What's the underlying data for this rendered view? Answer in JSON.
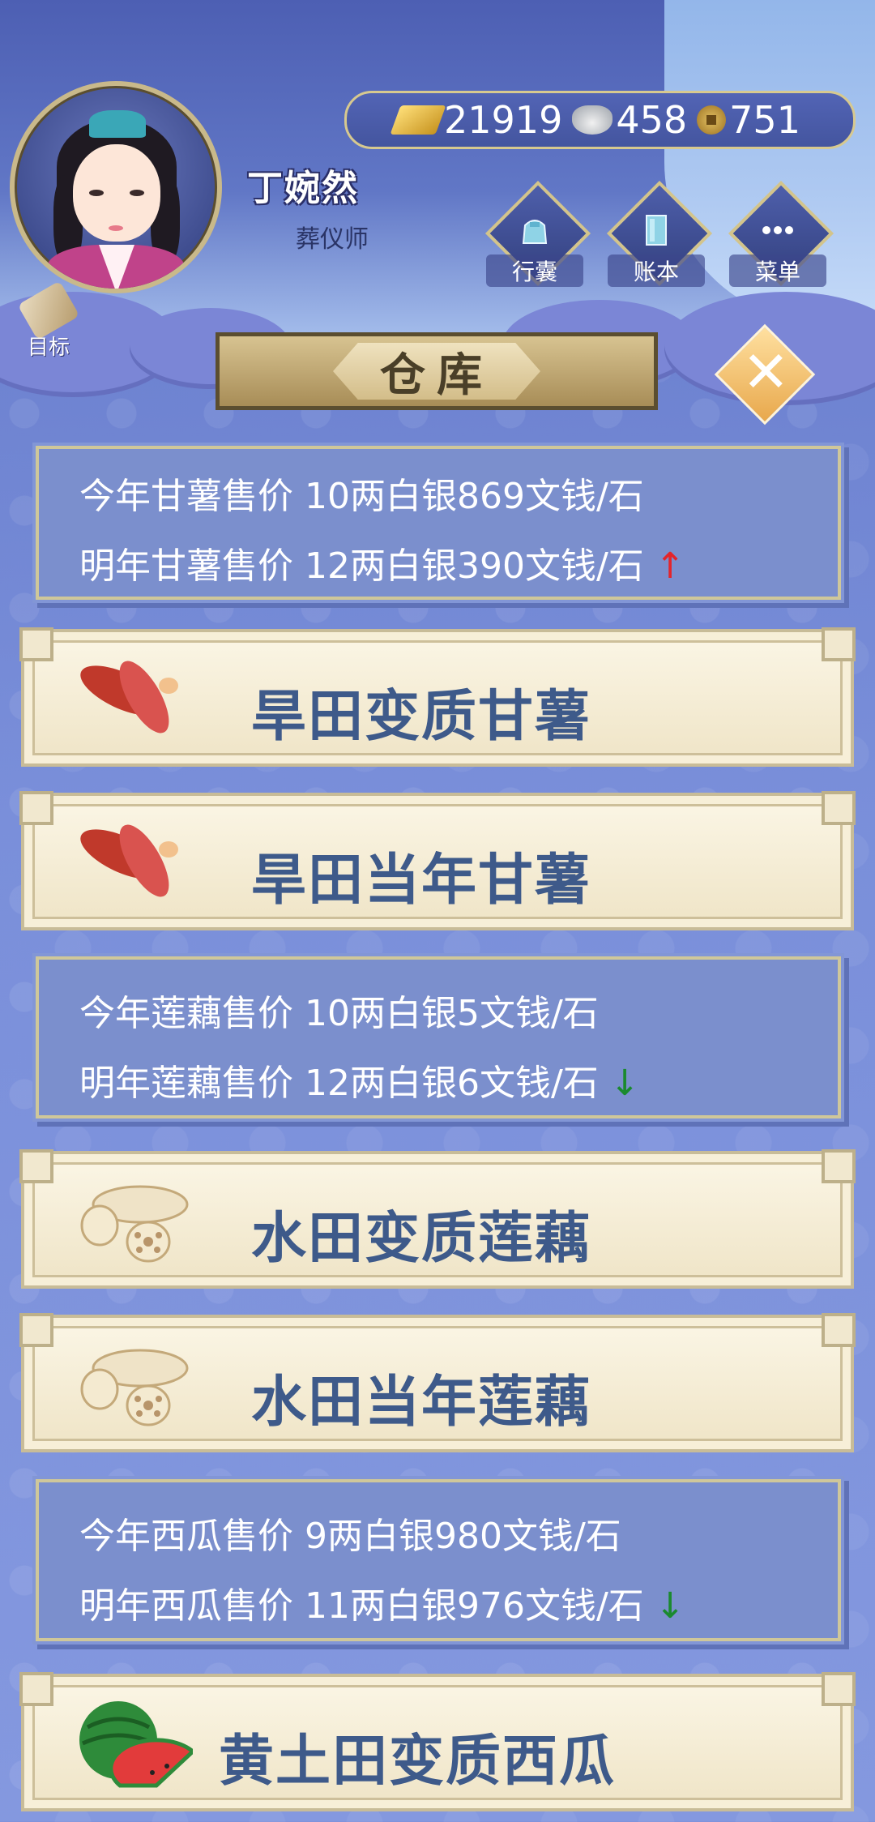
{
  "player": {
    "name": "丁婉然",
    "role": "葬仪师"
  },
  "currency": {
    "gold": "21919",
    "silver": "458",
    "coins": "751"
  },
  "menu": {
    "bag": "行囊",
    "ledger": "账本",
    "menu": "菜单",
    "goal": "目标"
  },
  "panel": {
    "title": "仓库",
    "close_icon": "✕"
  },
  "prices": [
    {
      "this_year": "今年甘薯售价 10两白银869文钱/石",
      "next_year": "明年甘薯售价 12两白银390文钱/石",
      "trend": "↑",
      "trend_color": "#e4242a"
    },
    {
      "this_year": "今年莲藕售价 10两白银5文钱/石",
      "next_year": "明年莲藕售价 12两白银6文钱/石",
      "trend": "↓",
      "trend_color": "#1a8a2e"
    },
    {
      "this_year": "今年西瓜售价 9两白银980文钱/石",
      "next_year": "明年西瓜售价 11两白银976文钱/石",
      "trend": "↓",
      "trend_color": "#1a8a2e"
    }
  ],
  "items": [
    {
      "name": "旱田变质甘薯",
      "icon": "sweet-potato-icon"
    },
    {
      "name": "旱田当年甘薯",
      "icon": "sweet-potato-icon"
    },
    {
      "name": "水田变质莲藕",
      "icon": "lotus-root-icon"
    },
    {
      "name": "水田当年莲藕",
      "icon": "lotus-root-icon"
    },
    {
      "name": "黄土田变质西瓜",
      "icon": "watermelon-icon"
    }
  ]
}
